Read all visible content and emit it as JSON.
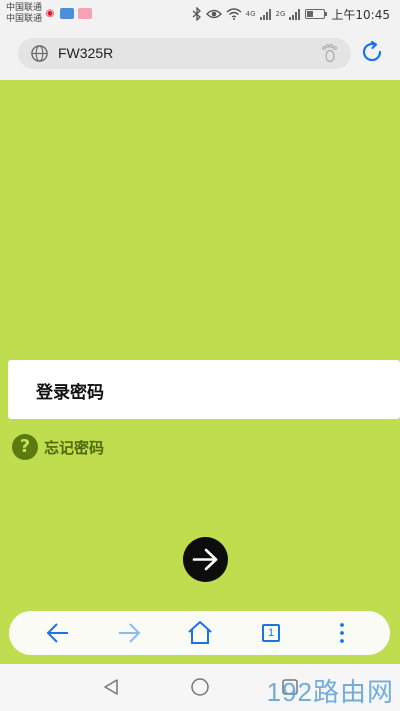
{
  "status_bar": {
    "carrier_1": "中国联通",
    "carrier_2": "中国联通",
    "net_1": "4G",
    "net_2": "2G",
    "time": "上午10:45",
    "battery_level": 0.4,
    "icons": [
      "weibo-icon",
      "app-notification-icon",
      "app-notification-icon",
      "bluetooth-icon",
      "eye-icon",
      "wifi-icon",
      "signal-icon",
      "battery-icon"
    ]
  },
  "address_bar": {
    "url": "FW325R",
    "leading_icon": "globe-icon",
    "trailing_icon": "footprint-icon",
    "refresh_icon": "refresh-icon"
  },
  "login": {
    "password_label": "登录密码",
    "forgot_password": "忘记密码",
    "forgot_icon_glyph": "?",
    "submit_icon": "arrow-right-icon"
  },
  "toolbar": {
    "back_icon": "arrow-left-icon",
    "forward_icon": "arrow-right-icon",
    "home_icon": "home-icon",
    "tab_count": "1",
    "menu_icon": "more-vertical-icon"
  },
  "watermark": "192路由网",
  "colors": {
    "page_background": "#bfdd4e",
    "accent_blue": "#1a73e8",
    "forgot_icon": "#5b7a10",
    "submit_button": "#0d0d0d"
  }
}
